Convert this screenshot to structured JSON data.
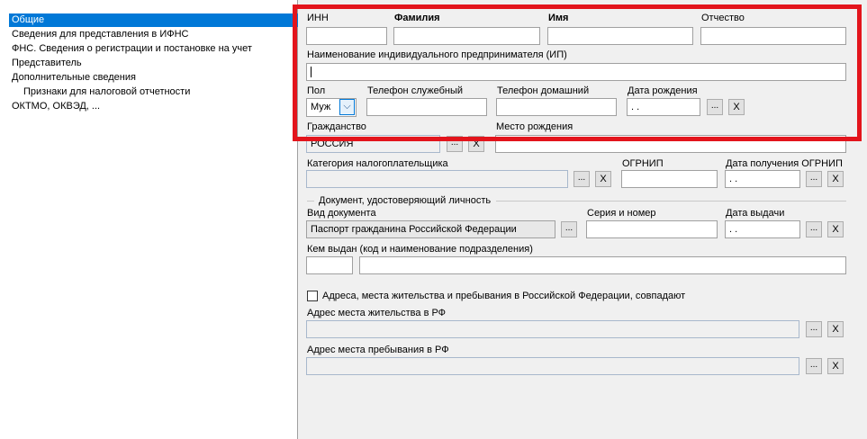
{
  "tree": {
    "items": [
      {
        "label": "Общие",
        "selected": true
      },
      {
        "label": "Сведения для представления в ИФНС"
      },
      {
        "label": "ФНС. Сведения о регистрации и постановке на учет"
      },
      {
        "label": "Представитель"
      },
      {
        "label": "Дополнительные сведения"
      },
      {
        "label": "Признаки для налоговой отчетности"
      },
      {
        "label": "ОКТМО, ОКВЭД, ..."
      }
    ]
  },
  "form": {
    "inn_label": "ИНН",
    "surname_label": "Фамилия",
    "name_label": "Имя",
    "patronymic_label": "Отчество",
    "ip_name_label": "Наименование индивидуального предпринимателя (ИП)",
    "gender_label": "Пол",
    "gender_value": "Муж",
    "work_phone_label": "Телефон служебный",
    "home_phone_label": "Телефон домашний",
    "birth_date_label": "Дата рождения",
    "birth_date_value": " .  .",
    "citizenship_label": "Гражданство",
    "citizenship_value": "РОССИЯ",
    "birth_place_label": "Место рождения",
    "taxpayer_category_label": "Категория налогоплательщика",
    "ogrnip_label": "ОГРНИП",
    "ogrnip_date_label": "Дата получения ОГРНИП",
    "ogrnip_date_value": " .  .",
    "id_doc_section": "Документ, удостоверяющий личность",
    "doc_type_label": "Вид документа",
    "doc_type_value": "Паспорт гражданина Российской Федерации",
    "series_number_label": "Серия и номер",
    "issue_date_label": "Дата выдачи",
    "issue_date_value": " .  .",
    "issued_by_label": "Кем выдан (код и наименование подразделения)",
    "address_match_label": "Адреса, места жительства и пребывания в Российской Федерации, совпадают",
    "residence_address_label": "Адрес места жительства в РФ",
    "stay_address_label": "Адрес места пребывания в РФ",
    "dots_button": "...",
    "clear_button": "X",
    "dropdown_arrow": "⌵"
  },
  "colors": {
    "highlight": "#e3141c",
    "selection": "#0078d7"
  }
}
